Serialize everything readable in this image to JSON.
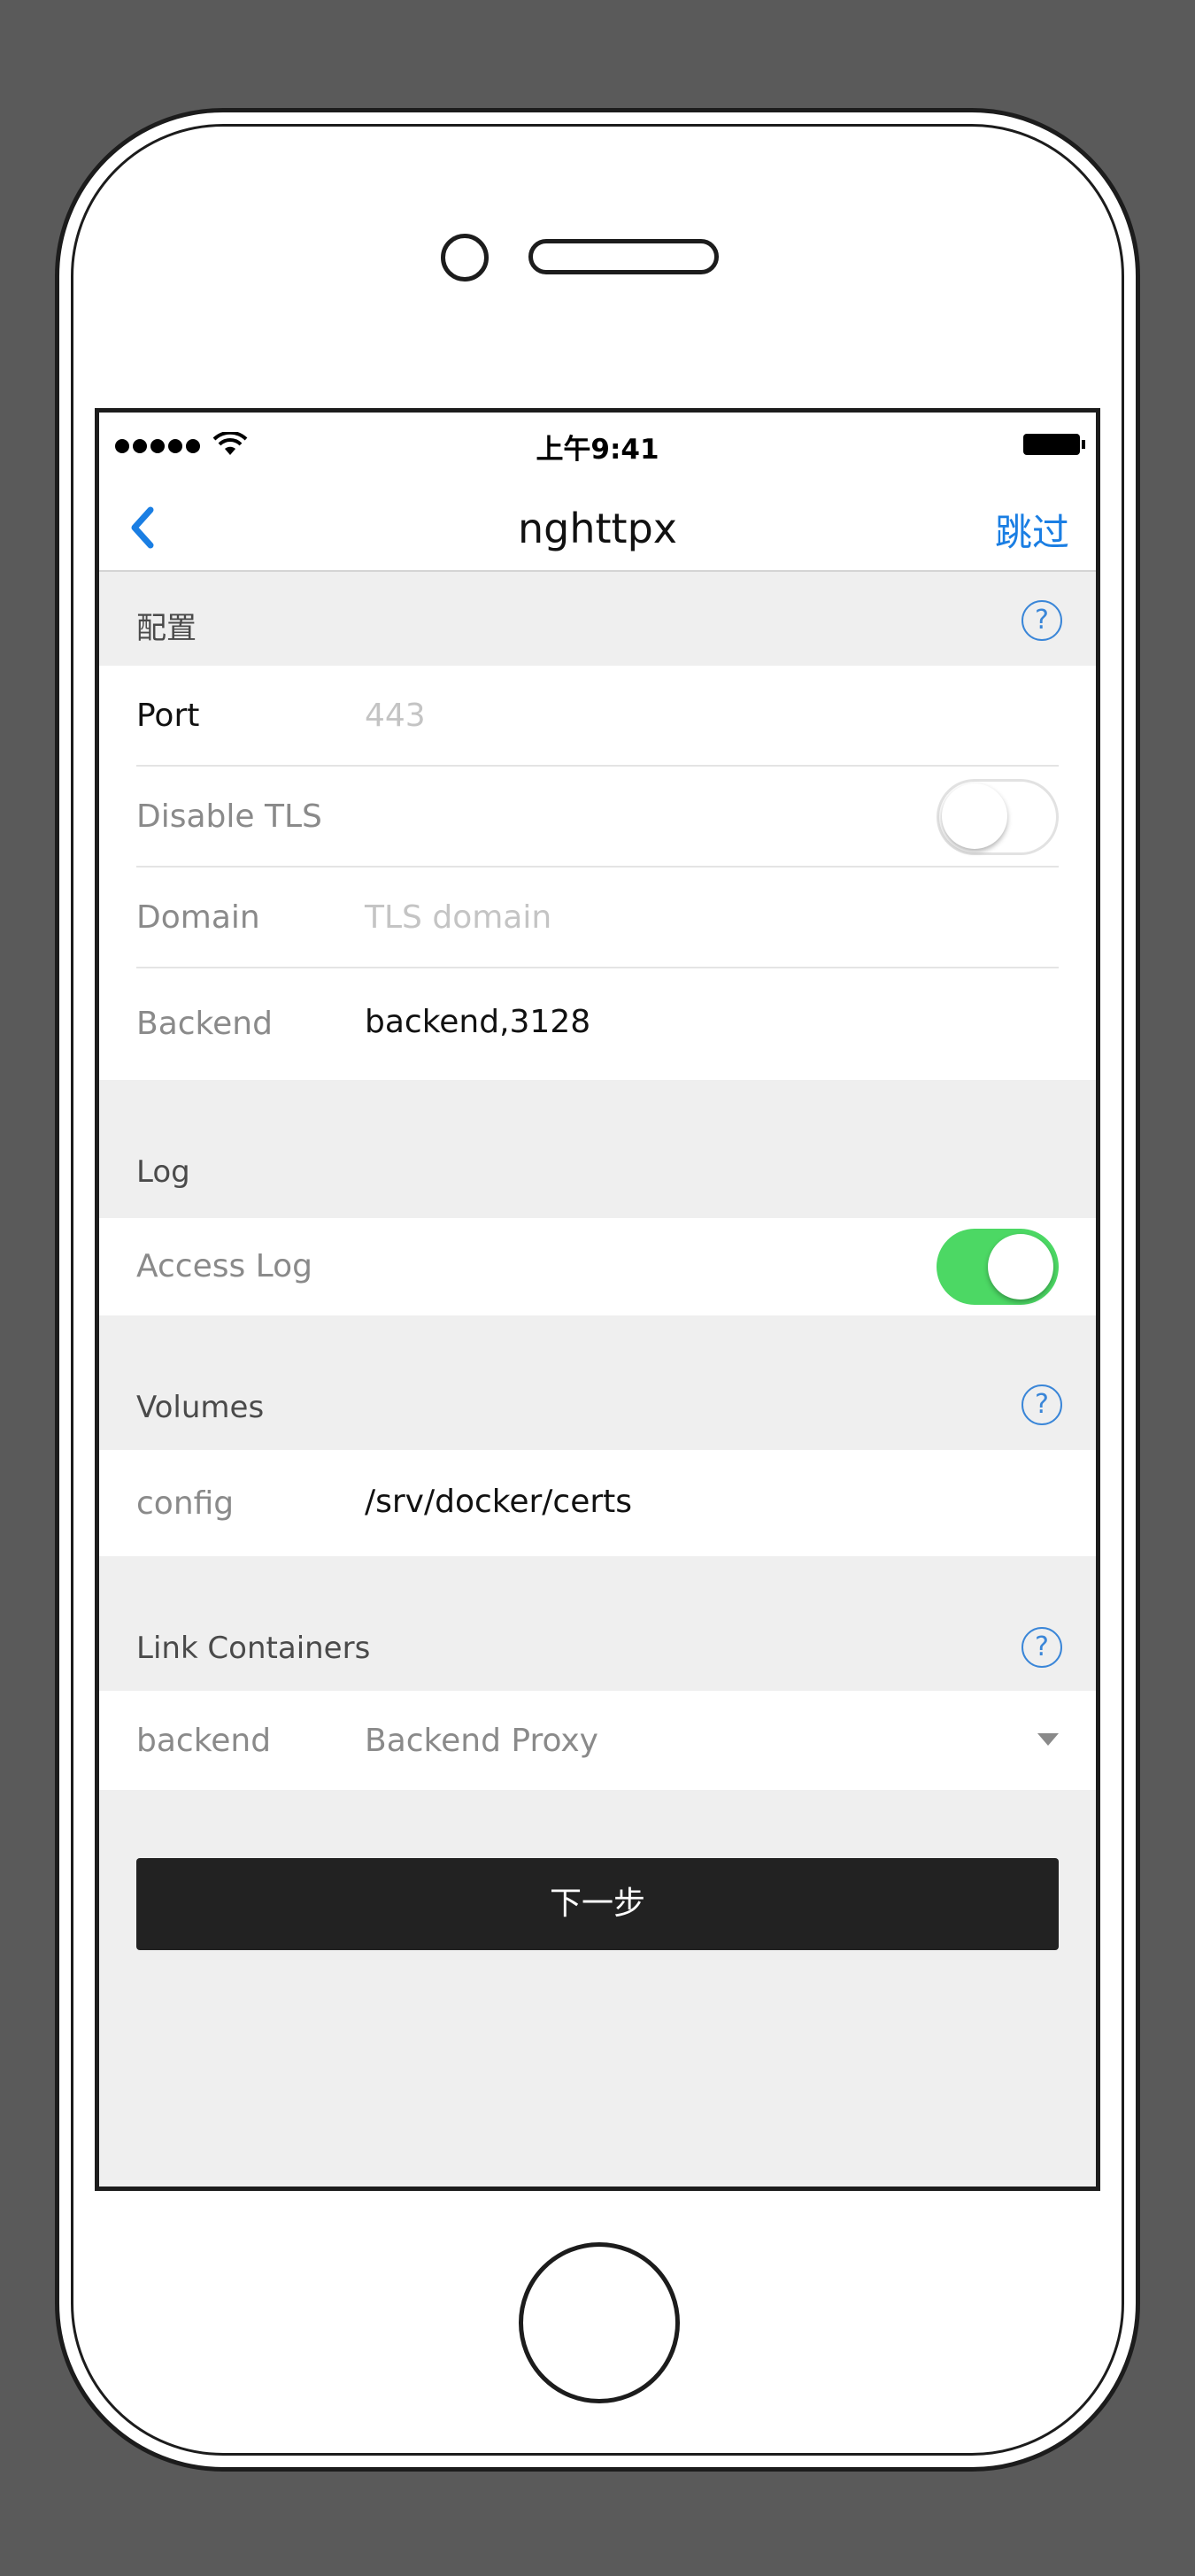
{
  "status_bar": {
    "time": "上午9:41"
  },
  "nav": {
    "title": "nghttpx",
    "back_icon": "chevron-left-icon",
    "skip_label": "跳过"
  },
  "sections": {
    "config": {
      "title": "配置",
      "help_icon": "question-circle-icon",
      "port": {
        "label": "Port",
        "placeholder": "443"
      },
      "disable_tls": {
        "label": "Disable TLS",
        "enabled": false
      },
      "domain": {
        "label": "Domain",
        "placeholder": "TLS domain"
      },
      "backend": {
        "label": "Backend",
        "value": "backend,3128"
      }
    },
    "log": {
      "title": "Log",
      "access_log": {
        "label": "Access Log",
        "enabled": true
      }
    },
    "volumes": {
      "title": "Volumes",
      "help_icon": "question-circle-icon",
      "config": {
        "label": "config",
        "value": "/srv/docker/certs"
      }
    },
    "link_containers": {
      "title": "Link Containers",
      "help_icon": "question-circle-icon",
      "backend": {
        "label": "backend",
        "value": "Backend Proxy"
      }
    }
  },
  "next_button": {
    "label": "下一步"
  },
  "colors": {
    "accent": "#1a7ee3",
    "toggle_on": "#4cd864",
    "primary_button": "#222222",
    "background": "#efefef"
  }
}
